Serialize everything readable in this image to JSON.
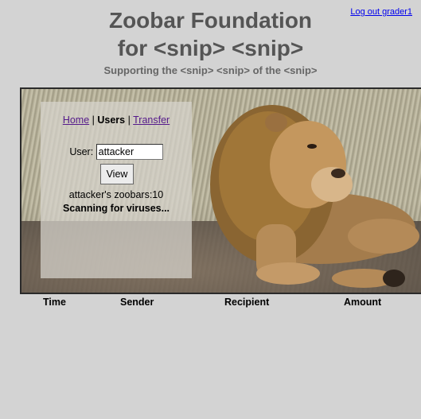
{
  "header": {
    "logout_link": "Log out grader1",
    "title_line1": "Zoobar Foundation",
    "title_line2": "for <snip> <snip>",
    "subtitle": "Supporting the <snip> <snip> of the <snip>"
  },
  "nav": {
    "home": "Home",
    "separator": "|",
    "users": "Users",
    "transfer": "Transfer"
  },
  "user_form": {
    "label": "User:",
    "value": "attacker",
    "view_button": "View"
  },
  "result": {
    "zoobars": "attacker's zoobars:10",
    "status": "Scanning for viruses..."
  },
  "transfers_table": {
    "headers": [
      "Time",
      "Sender",
      "Recipient",
      "Amount"
    ]
  },
  "colors": {
    "background": "#d3d3d3",
    "title": "#555555",
    "link": "#0000ee",
    "visited_link": "#551a8b"
  }
}
